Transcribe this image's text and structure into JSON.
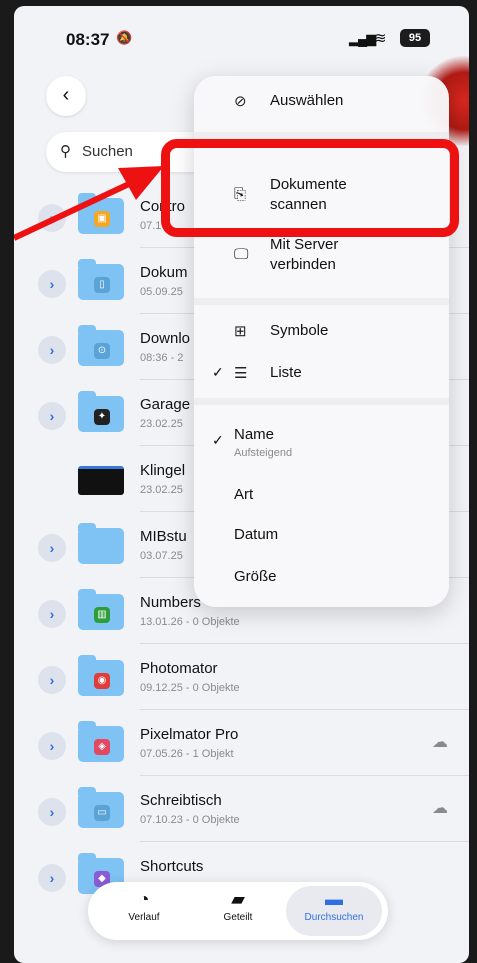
{
  "status": {
    "time": "08:37",
    "battery": "95"
  },
  "search": {
    "placeholder": "Suchen"
  },
  "files": [
    {
      "name": "Contro",
      "meta": "07.1",
      "badge_color": "#f5a623",
      "badge": "▣"
    },
    {
      "name": "Dokum",
      "meta": "05.09.25",
      "badge_color": "#7ec3f3",
      "badge": "▯"
    },
    {
      "name": "Downlo",
      "meta": "08:36 - 2",
      "badge_color": "#7ec3f3",
      "badge": "⊙"
    },
    {
      "name": "Garage",
      "meta": "23.02.25",
      "badge_color": "#222",
      "badge": "✦"
    },
    {
      "name": "Klingel",
      "meta": "23.02.25",
      "badge_color": "",
      "badge": ""
    },
    {
      "name": "MIBstu",
      "meta": "03.07.25",
      "badge_color": "",
      "badge": ""
    },
    {
      "name": "Numbers",
      "meta": "13.01.26 - 0 Objekte",
      "badge_color": "#2e9e3a",
      "badge": "▥"
    },
    {
      "name": "Photomator",
      "meta": "09.12.25 - 0 Objekte",
      "badge_color": "#e23b3b",
      "badge": "◉"
    },
    {
      "name": "Pixelmator Pro",
      "meta": "07.05.26 - 1 Objekt",
      "badge_color": "#e2485f",
      "badge": "◈"
    },
    {
      "name": "Schreibtisch",
      "meta": "07.10.23 - 0 Objekte",
      "badge_color": "#5aa3d6",
      "badge": "▭"
    },
    {
      "name": "Shortcuts",
      "meta": "",
      "badge_color": "#8a5cd6",
      "badge": "◆"
    }
  ],
  "menu": {
    "select": "Auswählen",
    "scan": "Dokumente scannen",
    "scan_line1": "Dokumente",
    "scan_line2": "scannen",
    "server_line1": "Mit Server",
    "server_line2": "verbinden",
    "icons": "Symbole",
    "list": "Liste",
    "name": "Name",
    "name_sub": "Aufsteigend",
    "kind": "Art",
    "date": "Datum",
    "size": "Größe"
  },
  "tabs": [
    {
      "label": "Verlauf",
      "icon": "clock-icon"
    },
    {
      "label": "Geteilt",
      "icon": "shared-folder-icon"
    },
    {
      "label": "Durchsuchen",
      "icon": "folder-icon"
    }
  ]
}
